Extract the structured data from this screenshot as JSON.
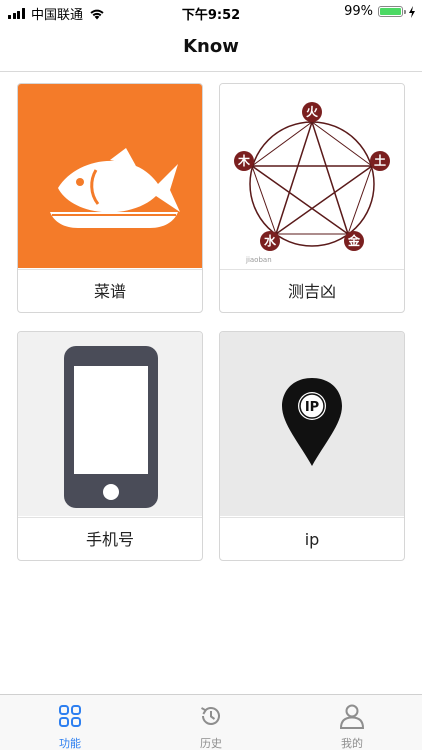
{
  "status_bar": {
    "carrier": "中国联通",
    "time": "下午9:52",
    "battery": "99%",
    "battery_level": 0.99
  },
  "nav": {
    "title": "Know"
  },
  "cards": [
    {
      "label": "菜谱",
      "icon": "fish-icon",
      "color": "#f47b29"
    },
    {
      "label": "测吉凶",
      "icon": "five-elements-icon",
      "elements": [
        "火",
        "土",
        "金",
        "水",
        "木"
      ],
      "watermark": "jiaoban"
    },
    {
      "label": "手机号",
      "icon": "phone-icon"
    },
    {
      "label": "ip",
      "icon": "ip-pin-icon",
      "pin_text": "IP"
    }
  ],
  "tabs": [
    {
      "label": "功能",
      "icon": "grid-icon",
      "active": true
    },
    {
      "label": "历史",
      "icon": "history-icon",
      "active": false
    },
    {
      "label": "我的",
      "icon": "profile-icon",
      "active": false
    }
  ],
  "colors": {
    "accent": "#2d7ff0",
    "battery": "#4cd964",
    "element_red": "#7a1f1f"
  }
}
